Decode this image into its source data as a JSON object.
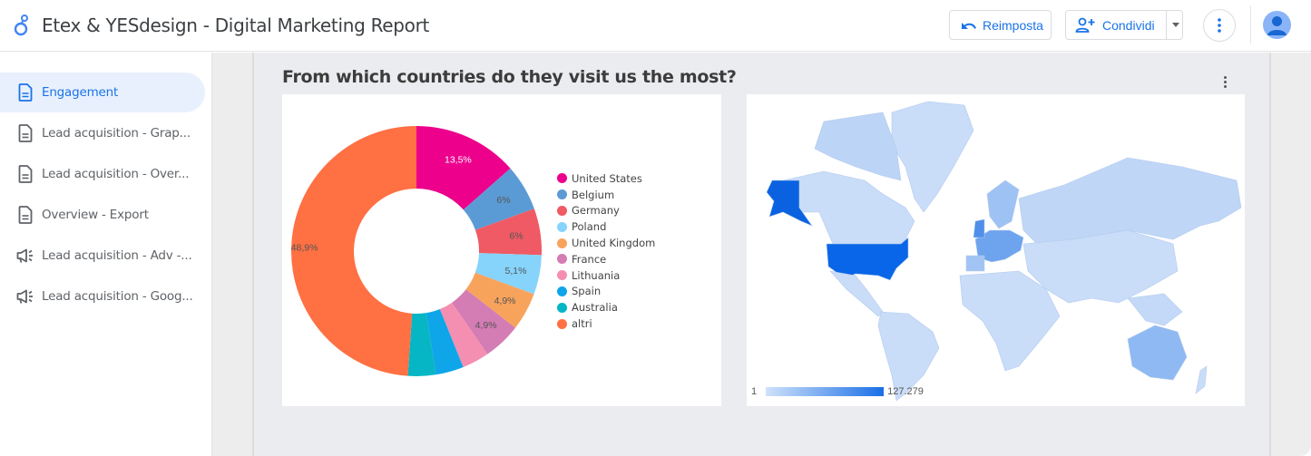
{
  "header": {
    "title": "Etex & YESdesign - Digital Marketing Report",
    "reset_label": "Reimposta",
    "share_label": "Condividi"
  },
  "sidebar": {
    "items": [
      {
        "label": "Engagement",
        "icon": "document-icon",
        "active": true
      },
      {
        "label": "Lead acquisition - Grap...",
        "icon": "document-icon",
        "active": false
      },
      {
        "label": "Lead acquisition - Over...",
        "icon": "document-icon",
        "active": false
      },
      {
        "label": "Overview - Export",
        "icon": "document-icon",
        "active": false
      },
      {
        "label": "Lead acquisition - Adv -...",
        "icon": "campaign-icon",
        "active": false
      },
      {
        "label": "Lead acquisition - Goog...",
        "icon": "campaign-icon",
        "active": false
      }
    ]
  },
  "section": {
    "title": "From which countries do they visit us the most?"
  },
  "chart_data": [
    {
      "type": "pie",
      "variant": "donut",
      "title": "",
      "categories": [
        "United States",
        "Belgium",
        "Germany",
        "Poland",
        "United Kingdom",
        "France",
        "Lithuania",
        "Spain",
        "Australia",
        "altri"
      ],
      "values": [
        13.5,
        6,
        6,
        5.1,
        4.9,
        4.9,
        3.5,
        3.6,
        3.6,
        48.9
      ],
      "labels": [
        "13,5%",
        "6%",
        "6%",
        "5,1%",
        "4,9%",
        "4,9%",
        "",
        "",
        "",
        "48,9%"
      ],
      "colors": [
        "#ec008c",
        "#5b9bd5",
        "#ef5a64",
        "#86d3fb",
        "#f7a35c",
        "#d47cb4",
        "#f48fb1",
        "#0ea5e9",
        "#06b6c4",
        "#ff7043"
      ],
      "legend_position": "right"
    },
    {
      "type": "heatmap",
      "variant": "geo-map",
      "title": "",
      "scale_min": "1",
      "scale_max": "127.279",
      "color_min": "#cfe2fb",
      "color_max": "#1a6fe6",
      "highlighted_regions": [
        "United States",
        "Western Europe",
        "Australia"
      ]
    }
  ]
}
